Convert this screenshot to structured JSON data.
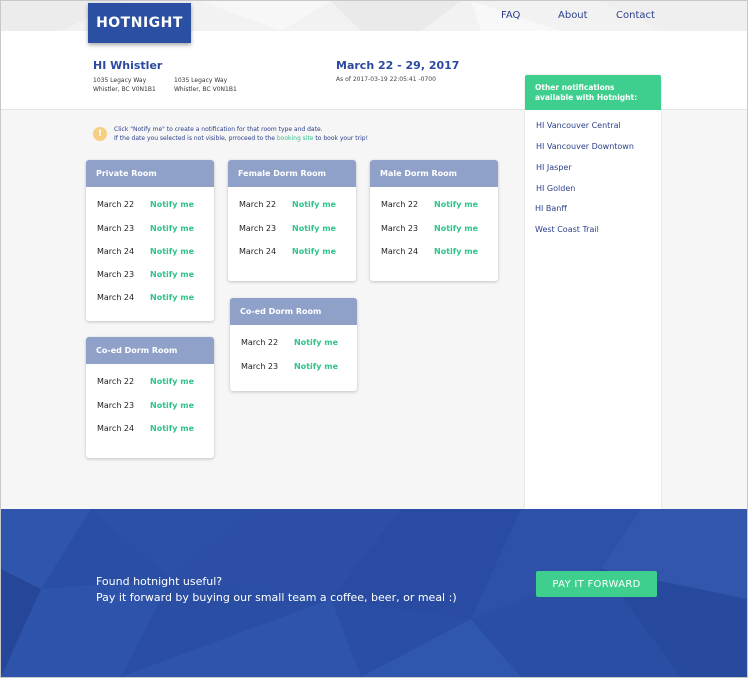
{
  "header": {
    "logo": "HOTNIGHT",
    "nav": [
      "FAQ",
      "About",
      "Contact"
    ]
  },
  "hostel": {
    "name": "HI Whistler",
    "address_1_line1": "1035 Legacy Way",
    "address_1_line2": "Whistler, BC V0N1B1",
    "address_2_line1": "1035 Legacy Way",
    "address_2_line2": "Whistler, BC V0N1B1",
    "date_range": "March 22 - 29, 2017",
    "as_of": "As of 2017-03-19 22:05:41 -0700"
  },
  "info": {
    "icon": "!",
    "line1": "Click \"Notify me\" to create a notification for that room type and date.",
    "line2_pre": "If the date you selected is not visible, prroceed to the ",
    "link": "booking site",
    "line2_post": " to book your trip!"
  },
  "rooms": [
    {
      "title": "Private Room",
      "rows": [
        {
          "date": "March 22",
          "action": "Notify me"
        },
        {
          "date": "March 23",
          "action": "Notify me"
        },
        {
          "date": "March 24",
          "action": "Notify me"
        },
        {
          "date": "March 23",
          "action": "Notify me"
        },
        {
          "date": "March 24",
          "action": "Notify me"
        }
      ]
    },
    {
      "title": "Female Dorm Room",
      "rows": [
        {
          "date": "March 22",
          "action": "Notify me"
        },
        {
          "date": "March 23",
          "action": "Notify me"
        },
        {
          "date": "March 24",
          "action": "Notify me"
        }
      ]
    },
    {
      "title": "Male Dorm Room",
      "rows": [
        {
          "date": "March 22",
          "action": "Notify me"
        },
        {
          "date": "March 23",
          "action": "Notify me"
        },
        {
          "date": "March 24",
          "action": "Notify me"
        }
      ]
    },
    {
      "title": "Co-ed Dorm Room",
      "rows": [
        {
          "date": "March 22",
          "action": "Notify me"
        },
        {
          "date": "March 23",
          "action": "Notify me"
        }
      ]
    },
    {
      "title": "Co-ed Dorm Room",
      "rows": [
        {
          "date": "March 22",
          "action": "Notify me"
        },
        {
          "date": "March 23",
          "action": "Notify me"
        },
        {
          "date": "March 24",
          "action": "Notify me"
        }
      ]
    }
  ],
  "sidebar": {
    "heading_line1": "Other notifications",
    "heading_line2": "available with Hotnight:",
    "links": [
      "HI Vancouver Central",
      "HI Vancouver Downtown",
      "HI Jasper",
      "HI Golden",
      "HI Banff",
      "West Coast Trail"
    ]
  },
  "footer": {
    "line1": "Found hotnight useful?",
    "line2": "Pay it forward by buying our small team a coffee, beer, or meal :)",
    "button": "PAY IT FORWARD"
  },
  "colors": {
    "brand_blue": "#2a4fa3",
    "accent_green": "#3ecf8e",
    "card_header": "#8fa1c9",
    "info_icon": "#f7cf83"
  }
}
